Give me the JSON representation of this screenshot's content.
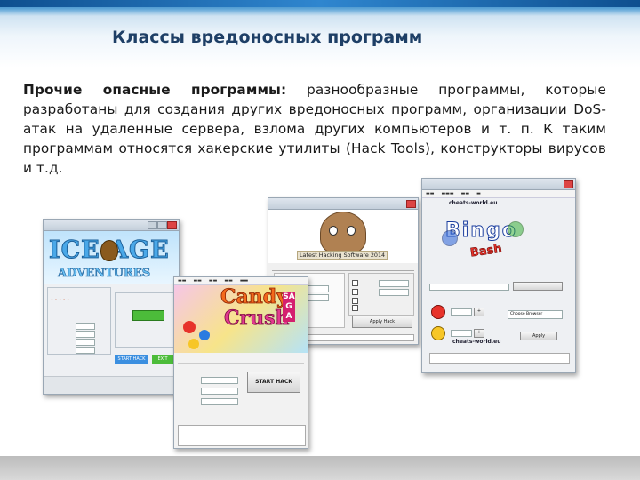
{
  "slide": {
    "title": "Классы вредоносных программ",
    "lead": "Прочие опасные программы:",
    "body": " разнообразные программы, которые разработаны для создания других вредоносных программ, организации DoS-атак на удаленные сервера, взлома других компьютеров и т. п. К таким программам относятся хакерские утилиты (Hack Tools), конструкторы вирусов и т.д."
  },
  "screens": {
    "ice_age": {
      "logo_line1": "ICE AGE",
      "logo_line2": "ADVENTURES",
      "start_label": "START HACK",
      "exit_label": "EXIT"
    },
    "pou": {
      "banner": "Latest Hacking Software 2014",
      "apply_label": "Apply Hack"
    },
    "candy": {
      "logo_word1": "Candy",
      "logo_word2": "Crush",
      "logo_word3": "SAGA",
      "start_label": "START HACK"
    },
    "bingo": {
      "site_top": "cheats-world.eu",
      "logo_word1": "Bingo",
      "logo_word2": "Bash",
      "site_bottom": "cheats-world.eu",
      "select_value": "Choose Browser",
      "apply_label": "Apply"
    }
  },
  "colors": {
    "title": "#1e3f66",
    "band": "#2f86cf"
  }
}
